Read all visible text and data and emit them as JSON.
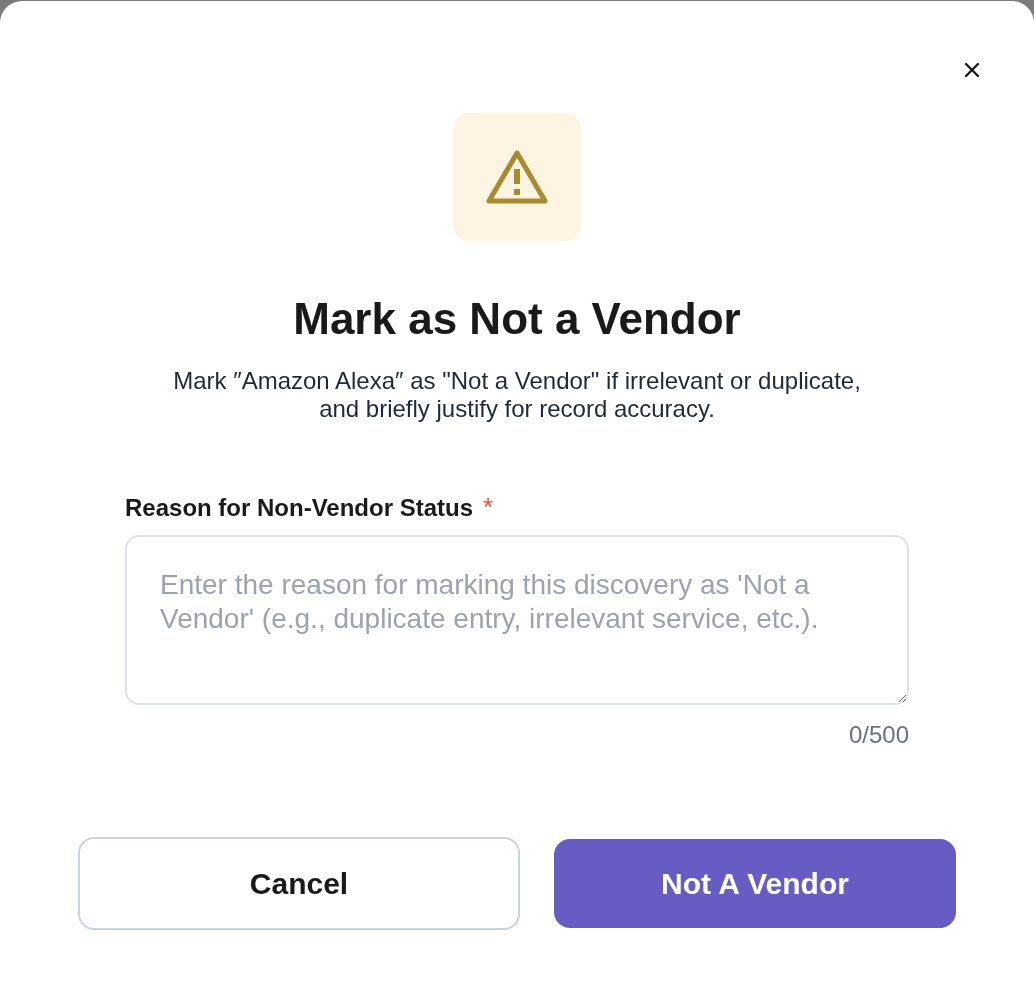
{
  "dialog": {
    "title": "Mark as Not a Vendor",
    "description": "Mark ″Amazon Alexa″ as \"Not a Vendor\" if irrelevant or duplicate, and briefly justify for record accuracy.",
    "field": {
      "label": "Reason for Non-Vendor Status",
      "required": true,
      "required_mark": "*",
      "placeholder": "Enter the reason for marking this discovery as 'Not a Vendor' (e.g., duplicate entry, irrelevant service, etc.).",
      "counter": "0/500"
    },
    "buttons": [
      {
        "label": "Cancel",
        "kind": "secondary"
      },
      {
        "label": "Not A Vendor",
        "kind": "primary"
      }
    ]
  }
}
